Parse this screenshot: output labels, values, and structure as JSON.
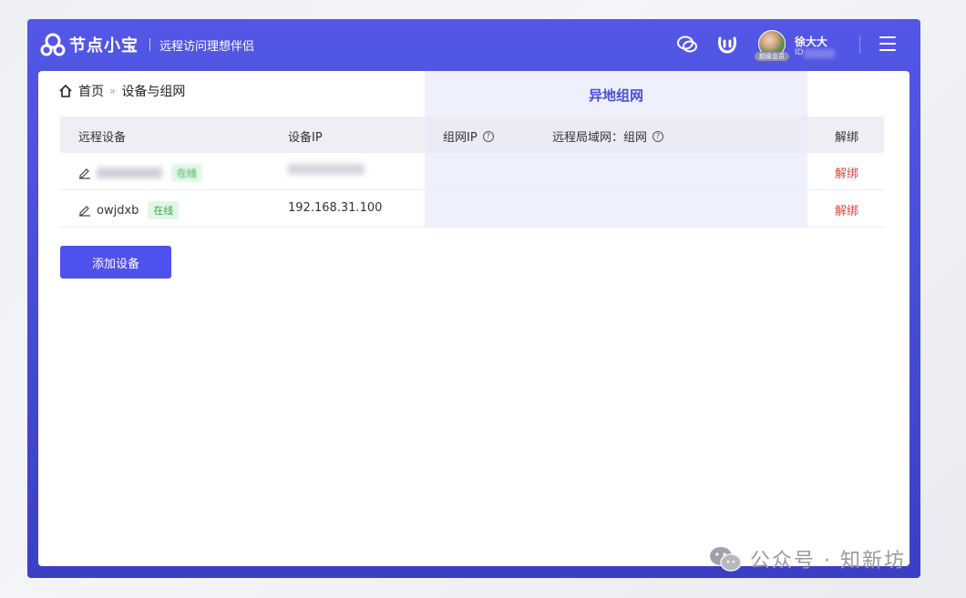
{
  "app": {
    "name": "节点小宝",
    "slogan": "远程访问理想伴侣"
  },
  "user": {
    "name": "徐大大",
    "id_prefix": "ID",
    "vip_badge": "超级会员"
  },
  "breadcrumb": {
    "home": "首页",
    "current": "设备与组网"
  },
  "remote_panel": {
    "title": "异地组网"
  },
  "table": {
    "headers": {
      "device": "远程设备",
      "device_ip": "设备IP",
      "group_ip": "组网IP",
      "remote_lan": "远程局域网：组网",
      "unbind": "解绑"
    },
    "rows": [
      {
        "name": "",
        "status": "在线",
        "ip": "",
        "unbind": "解绑",
        "obscured": true
      },
      {
        "name": "owjdxb",
        "status": "在线",
        "ip": "192.168.31.100",
        "unbind": "解绑",
        "obscured": false
      }
    ]
  },
  "actions": {
    "add_device": "添加设备"
  },
  "watermark": "公众号 · 知新坊",
  "colors": {
    "brand": "#4a4fd9",
    "online": "#2ea84a",
    "danger": "#e3433b"
  }
}
